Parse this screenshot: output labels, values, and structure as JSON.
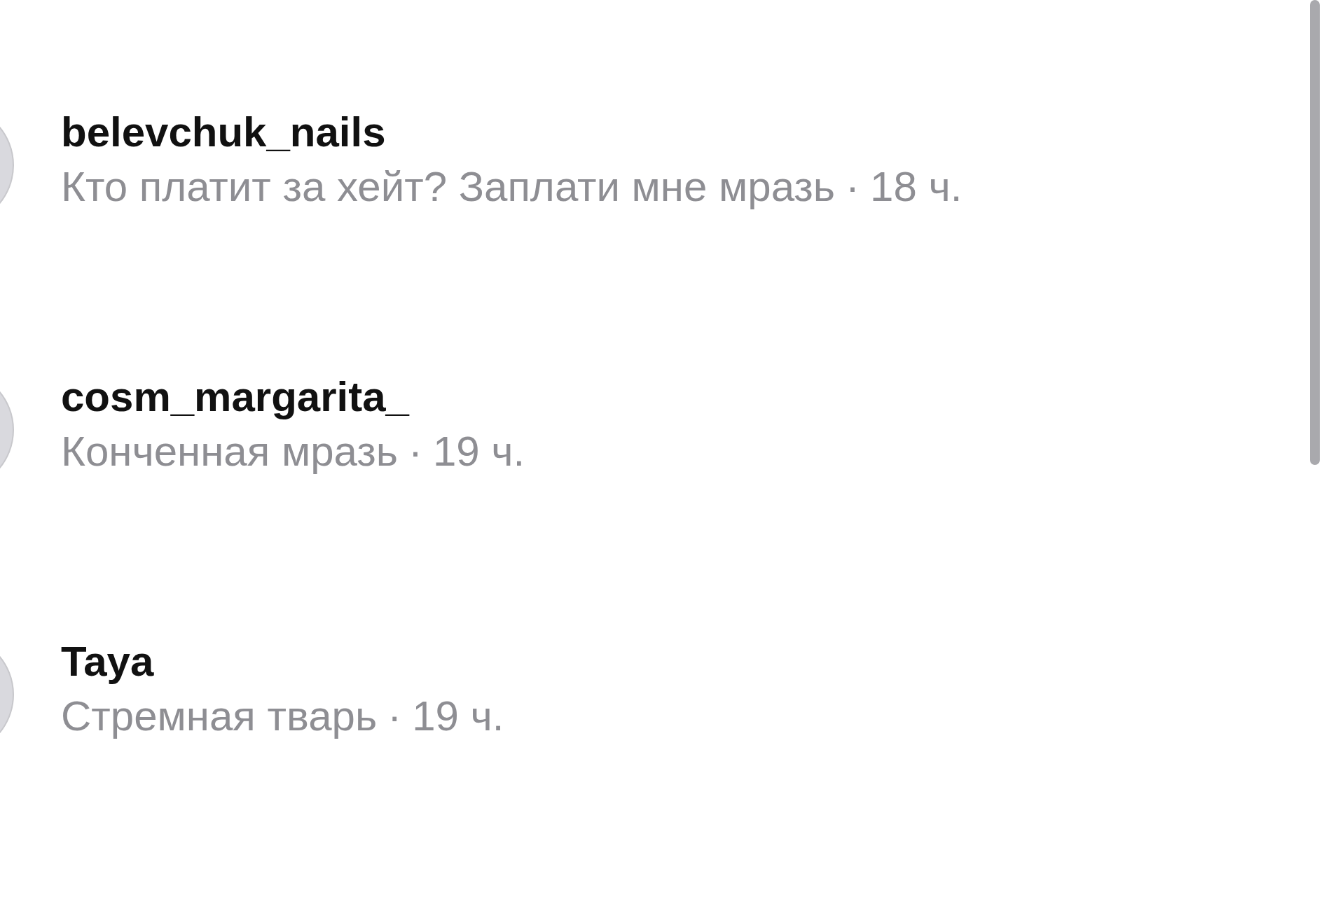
{
  "comments": [
    {
      "username": "belevchuk_nails",
      "text": "Кто платит за хейт? Заплати мне мразь",
      "separator": "·",
      "time": "18 ч."
    },
    {
      "username": "cosm_margarita_",
      "text": "Конченная мразь",
      "separator": "·",
      "time": "19 ч."
    },
    {
      "username": "Taya",
      "text": "Стремная тварь",
      "separator": "·",
      "time": "19 ч."
    }
  ]
}
